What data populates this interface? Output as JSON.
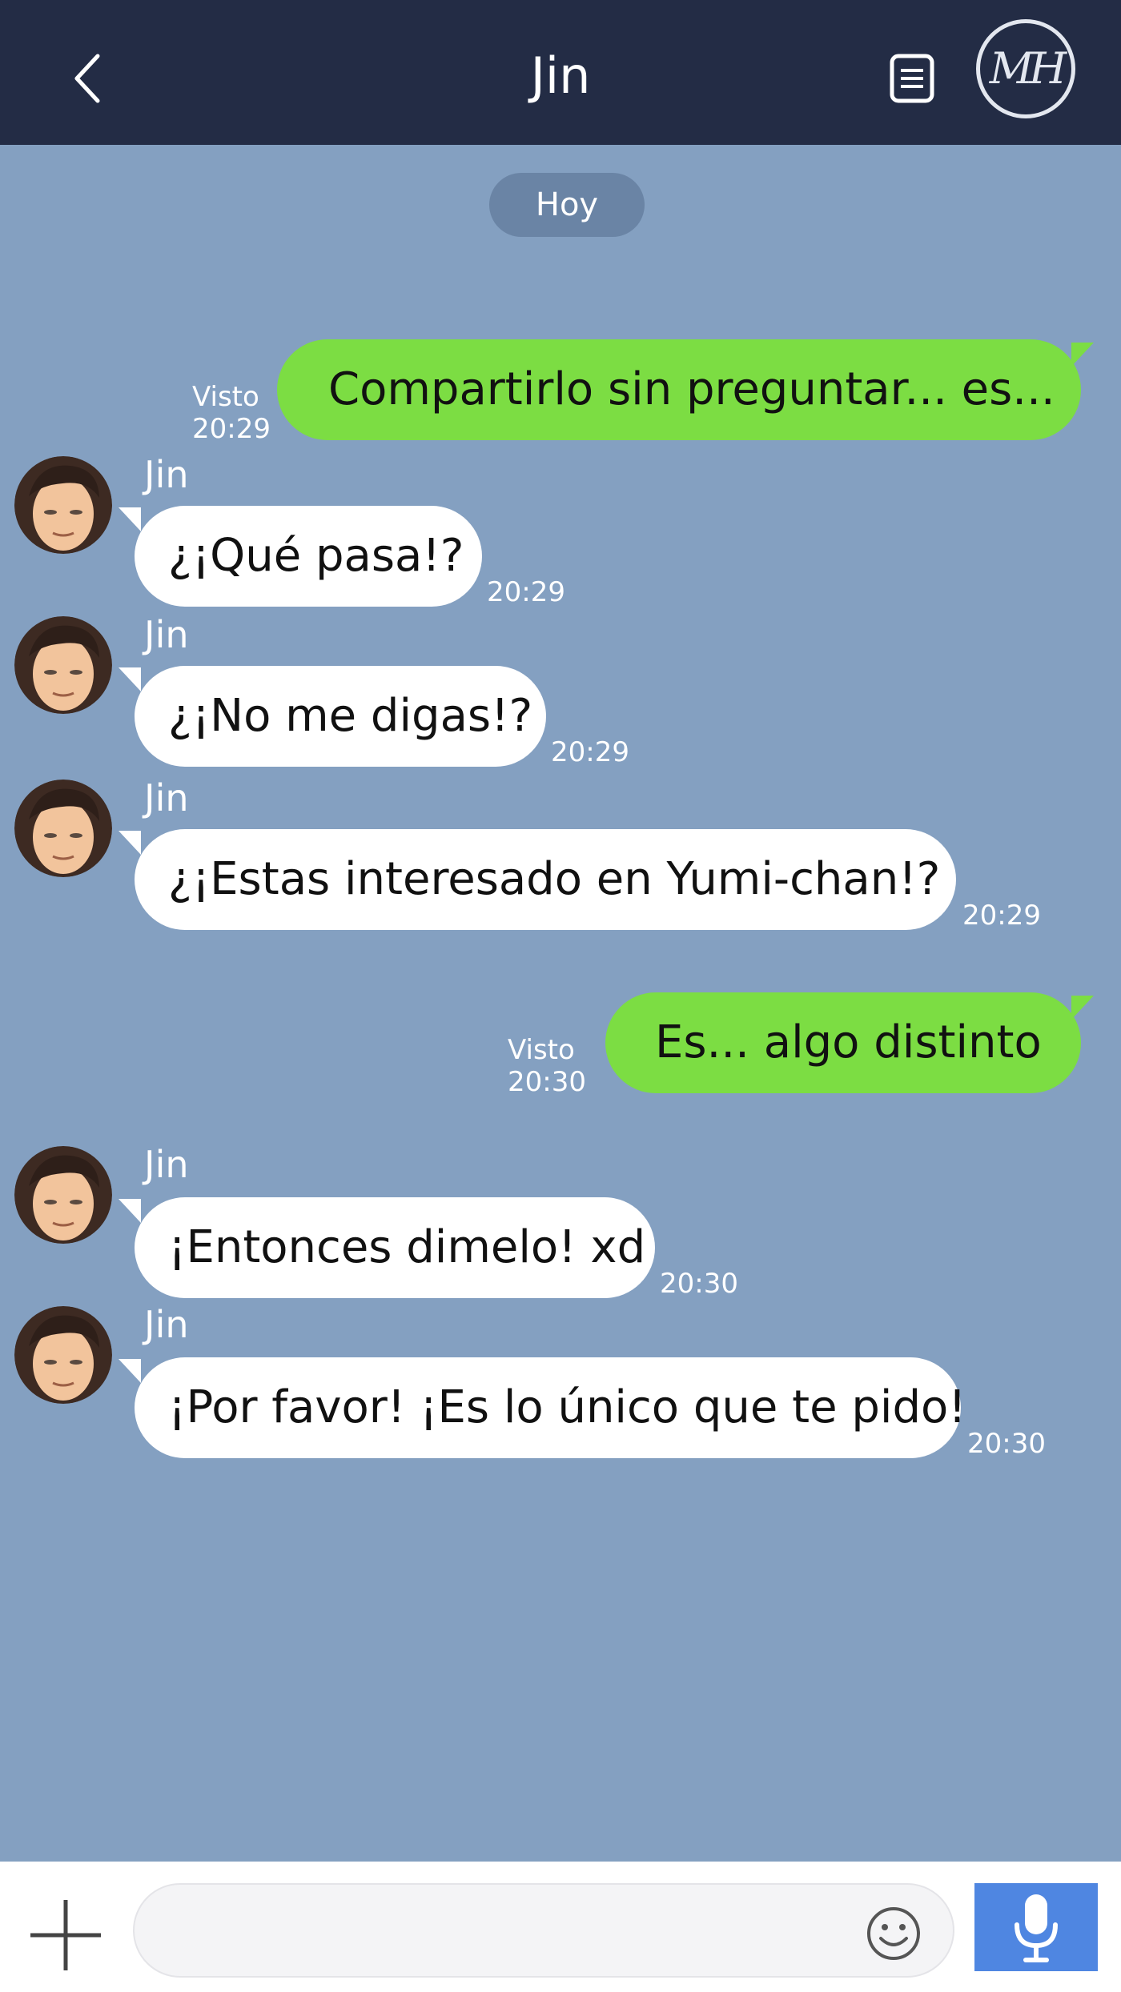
{
  "header": {
    "title": "Jin",
    "logo_text": "MH"
  },
  "date_divider": "Hoy",
  "messages": [
    {
      "direction": "outgoing",
      "text": "Compartirlo sin preguntar... es...",
      "seen_label": "Visto",
      "time": "20:29"
    },
    {
      "direction": "incoming",
      "sender": "Jin",
      "text": "¿¡Qué pasa!?",
      "time": "20:29"
    },
    {
      "direction": "incoming",
      "sender": "Jin",
      "text": "¿¡No me digas!?",
      "time": "20:29"
    },
    {
      "direction": "incoming",
      "sender": "Jin",
      "text": "¿¡Estas interesado en Yumi-chan!?",
      "time": "20:29"
    },
    {
      "direction": "outgoing",
      "text": "Es... algo distinto",
      "seen_label": "Visto",
      "time": "20:30"
    },
    {
      "direction": "incoming",
      "sender": "Jin",
      "text": "¡Entonces dimelo! xd",
      "time": "20:30"
    },
    {
      "direction": "incoming",
      "sender": "Jin",
      "text": "¡Por favor! ¡Es lo único que te pido!",
      "time": "20:30"
    }
  ],
  "composer": {
    "placeholder": ""
  },
  "icons": {
    "back": "chevron-left-icon",
    "notes": "notes-icon",
    "add": "plus-icon",
    "emoji": "smiley-icon",
    "voice": "microphone-icon"
  },
  "colors": {
    "header_bg": "#232c45",
    "chat_bg": "#84a0c1",
    "outgoing_bubble": "#7cdd43",
    "incoming_bubble": "#ffffff",
    "mic_button": "#4f86e1"
  }
}
